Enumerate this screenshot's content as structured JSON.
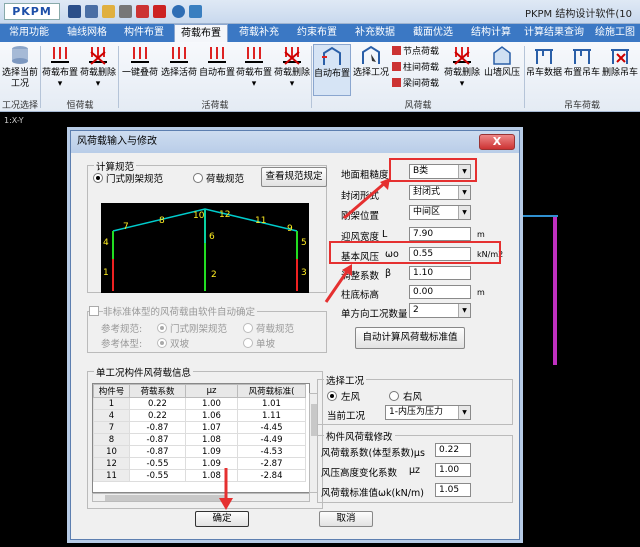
{
  "app": {
    "logo_main": "PKPM",
    "title": "PKPM 结构设计软件(10"
  },
  "ribbon_tabs": [
    "常用功能",
    "轴线网格",
    "构件布置",
    "荷载布置",
    "荷载补充",
    "约束布置",
    "补充数据",
    "截面优选",
    "结构计算",
    "计算结果查询",
    "绘施工图"
  ],
  "active_tab": "荷载布置",
  "ribbon": {
    "buttons": [
      {
        "label": "选择当前\n工况"
      },
      {
        "label": "荷载布置\n▾"
      },
      {
        "label": "荷载删除\n▾"
      },
      {
        "label": "一键叠荷"
      },
      {
        "label": "选择活荷"
      },
      {
        "label": "自动布置"
      },
      {
        "label": "荷载布置\n▾"
      },
      {
        "label": "荷载删除\n▾"
      },
      {
        "label": "自动布置"
      },
      {
        "label": "选择工况"
      },
      {
        "label": "荷载删除\n▾"
      },
      {
        "label": "山墙风压"
      },
      {
        "label": "吊车数据"
      },
      {
        "label": "布置吊车"
      },
      {
        "label": "删除吊车"
      }
    ],
    "mini_items": [
      "节点荷载",
      "柱间荷载",
      "梁间荷载"
    ],
    "groups": [
      "工况选择",
      "恒荷载",
      "活荷载",
      "风荷载",
      "吊车荷载"
    ]
  },
  "canvas_label": "1:X-Y",
  "dialog": {
    "title": "风荷载输入与修改",
    "close_label": "X",
    "calc_spec": {
      "legend": "计算规范",
      "options": [
        "门式刚架规范",
        "荷载规范"
      ],
      "selected": "门式刚架规范",
      "view_button": "查看规范规定"
    },
    "frame_labels": [
      "1",
      "2",
      "3",
      "4",
      "5",
      "6",
      "7",
      "8",
      "9",
      "10",
      "11",
      "12"
    ],
    "nonstandard": {
      "checkbox_label": "非标准体型的风荷载由软件自动确定",
      "ref_spec_label": "参考规范:",
      "ref_spec_options": [
        "门式刚架规范",
        "荷载规范"
      ],
      "ref_shape_label": "参考体型:",
      "ref_shape_options": [
        "双坡",
        "单坡"
      ]
    },
    "params": {
      "roughness_label": "地面粗糙度",
      "roughness_value": "B类",
      "enclosure_label": "封闭形式",
      "enclosure_value": "封闭式",
      "position_label": "刚架位置",
      "position_value": "中间区",
      "width_label": "迎风宽度",
      "width_symbol": "L",
      "width_value": "7.90",
      "width_unit": "m",
      "pressure_label": "基本风压",
      "pressure_symbol": "ωo",
      "pressure_value": "0.55",
      "pressure_unit": "kN/m2",
      "factor_label": "调整系数",
      "factor_symbol": "β",
      "factor_value": "1.10",
      "base_label": "柱底标高",
      "base_value": "0.00",
      "base_unit": "m",
      "count_label": "单方向工况数量",
      "count_value": "2",
      "auto_button": "自动计算风荷载标准值"
    },
    "table": {
      "legend": "单工况构件风荷载信息",
      "headers": [
        "构件号",
        "荷载系数",
        "μz",
        "风荷载标准("
      ],
      "rows": [
        [
          "1",
          "0.22",
          "1.00",
          "1.01"
        ],
        [
          "4",
          "0.22",
          "1.06",
          "1.11"
        ],
        [
          "7",
          "-0.87",
          "1.07",
          "-4.45"
        ],
        [
          "8",
          "-0.87",
          "1.08",
          "-4.49"
        ],
        [
          "10",
          "-0.87",
          "1.09",
          "-4.53"
        ],
        [
          "12",
          "-0.55",
          "1.09",
          "-2.87"
        ],
        [
          "11",
          "-0.55",
          "1.08",
          "-2.84"
        ]
      ]
    },
    "case_select": {
      "legend": "选择工况",
      "options": [
        "左风",
        "右风"
      ],
      "selected": "左风",
      "current_label": "当前工况",
      "current_value": "1-内压为压力"
    },
    "member_modify": {
      "legend": "构件风荷载修改",
      "coef_label": "风荷载系数(体型系数)μs",
      "coef_value": "0.22",
      "height_label": "风压高度变化系数",
      "height_symbol": "μz",
      "height_value": "1.00",
      "std_label": "风荷载标准值ωk(kN/m)",
      "std_value": "1.05"
    },
    "ok_button": "确定",
    "cancel_button": "取消"
  },
  "colors": {
    "tab_bar": "#3b78c4",
    "highlight": "#e53030",
    "frame_beam": "#00cccc",
    "column_green": "#22dd22",
    "column_red": "#ee2222",
    "label_yellow": "#ffee22"
  }
}
